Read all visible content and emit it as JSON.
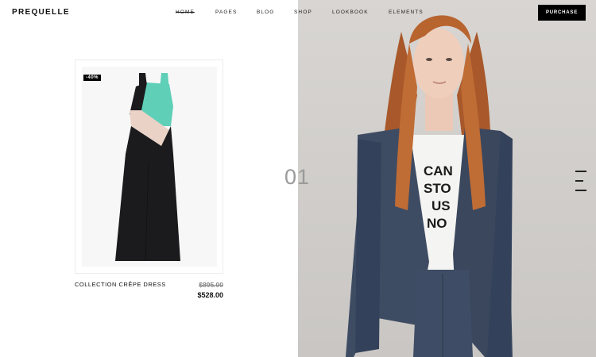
{
  "header": {
    "logo": "PREQUELLE",
    "nav": [
      {
        "label": "HOME",
        "active": true
      },
      {
        "label": "PAGES",
        "active": false
      },
      {
        "label": "BLOG",
        "active": false
      },
      {
        "label": "SHOP",
        "active": false
      },
      {
        "label": "LOOKBOOK",
        "active": false
      },
      {
        "label": "ELEMENTS",
        "active": false
      }
    ],
    "purchase_label": "PURCHASE"
  },
  "product": {
    "badge": "-40%",
    "name": "COLLECTION CRÊPE DRESS",
    "old_price": "$895.00",
    "new_price": "$528.00",
    "colors": {
      "teal": "#5fcfb8",
      "blush": "#ead2c6",
      "black": "#1b1b1d"
    }
  },
  "slider": {
    "number": "01"
  },
  "hero": {
    "tshirt_text": [
      "CAN",
      "STO",
      "US",
      "NO"
    ],
    "colors": {
      "hair": "#b5632f",
      "jacket": "#3c4a62",
      "background": "#d6d3d0"
    }
  },
  "menu_icon": "hamburger-icon"
}
